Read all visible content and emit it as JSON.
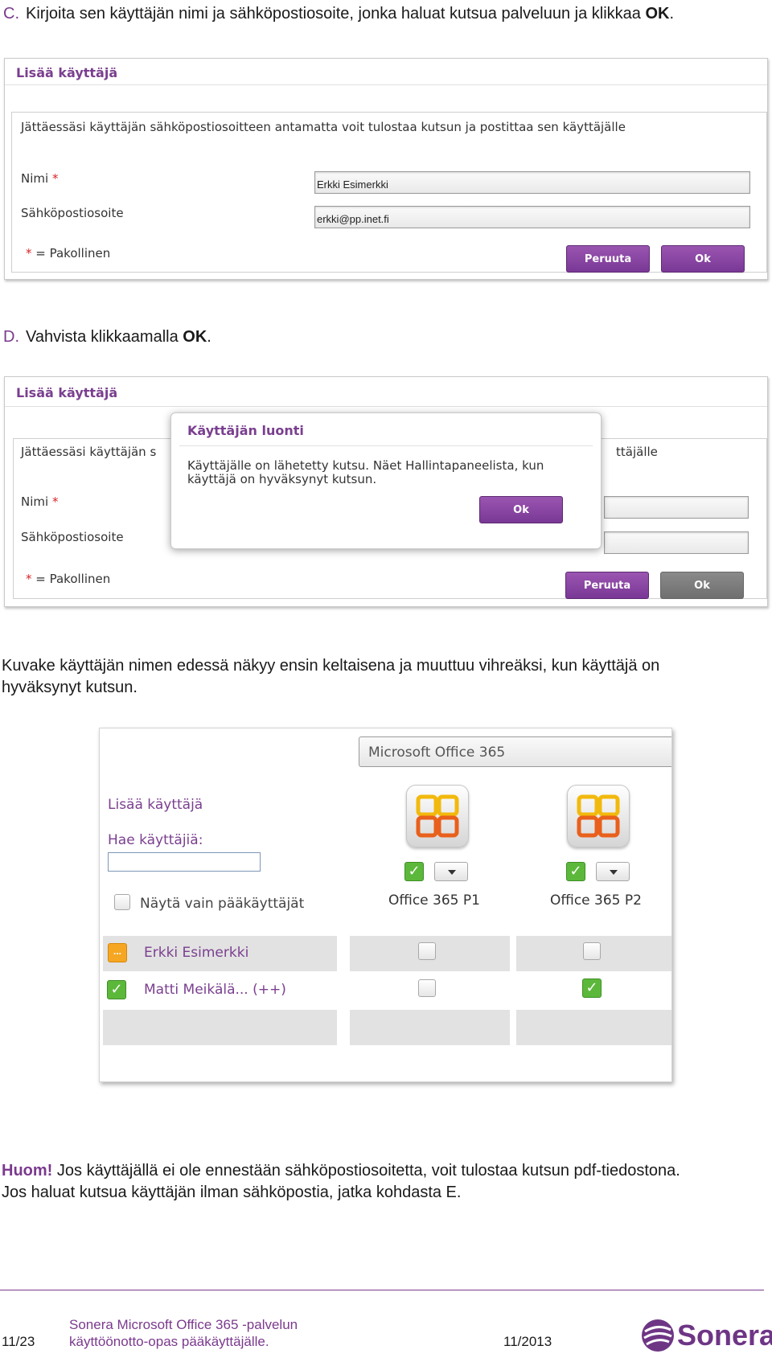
{
  "step_c": {
    "letter": "C.",
    "text": "Kirjoita sen käyttäjän nimi ja sähköpostiosoite, jonka haluat kutsua palveluun ja klikkaa ",
    "bold": "OK",
    "end": "."
  },
  "dialog1": {
    "title": "Lisää käyttäjä",
    "info": "Jättäessäsi käyttäjän sähköpostiosoitteen antamatta voit tulostaa kutsun ja postittaa sen käyttäjälle",
    "name_label": "Nimi",
    "required_mark": "*",
    "email_label": "Sähköpostiosoite",
    "name_value": "Erkki Esimerkki",
    "email_value": "erkki@pp.inet.fi",
    "legend_star": "*",
    "legend_text": "= Pakollinen",
    "cancel": "Peruuta",
    "ok": "Ok"
  },
  "step_d": {
    "letter": "D.",
    "text": "Vahvista klikkaamalla ",
    "bold": "OK",
    "end": "."
  },
  "dialog2": {
    "title": "Lisää käyttäjä",
    "info_left": "Jättäessäsi käyttäjän s",
    "info_right": "ttäjälle",
    "name_label": "Nimi",
    "required_mark": "*",
    "email_label": "Sähköpostiosoite",
    "legend_star": "*",
    "legend_text": "= Pakollinen",
    "cancel": "Peruuta",
    "ok": "Ok",
    "modal": {
      "title": "Käyttäjän luonti",
      "line1": "Käyttäjälle on lähetetty kutsu. Näet Hallintapaneelista, kun",
      "line2": "käyttäjä on hyväksynyt kutsun.",
      "ok": "Ok"
    }
  },
  "para1": "Kuvake käyttäjän nimen edessä näkyy ensin keltaisena ja muuttuu vihreäksi, kun käyttäjä on hyväksynyt kutsun.",
  "shot3": {
    "product_select": "Microsoft Office 365",
    "add_user": "Lisää käyttäjä",
    "search_label": "Hae käyttäjiä:",
    "admins_only": "Näytä vain pääkäyttäjät",
    "plans": [
      "Office 365 P1",
      "Office 365 P2"
    ],
    "users": [
      {
        "name": "Erkki Esimerkki",
        "status": "pending",
        "p1": false,
        "p2": false
      },
      {
        "name": "Matti Meikälä... (++)",
        "status": "accepted",
        "p1": false,
        "p2": true
      }
    ],
    "pending_glyph": "...",
    "check_glyph": "✓"
  },
  "note": {
    "huom": "Huom!",
    "line1": " Jos käyttäjällä ei ole ennestään sähköpostiosoitetta, voit tulostaa kutsun pdf-tiedostona.",
    "line2": "Jos haluat kutsua käyttäjän ilman sähköpostia, jatka kohdasta E."
  },
  "footer": {
    "page": "11/23",
    "doc_line1": "Sonera Microsoft Office 365 -palvelun",
    "doc_line2": "käyttöönotto-opas pääkäyttäjälle.",
    "date": "11/2013",
    "logo": "Sonera"
  }
}
